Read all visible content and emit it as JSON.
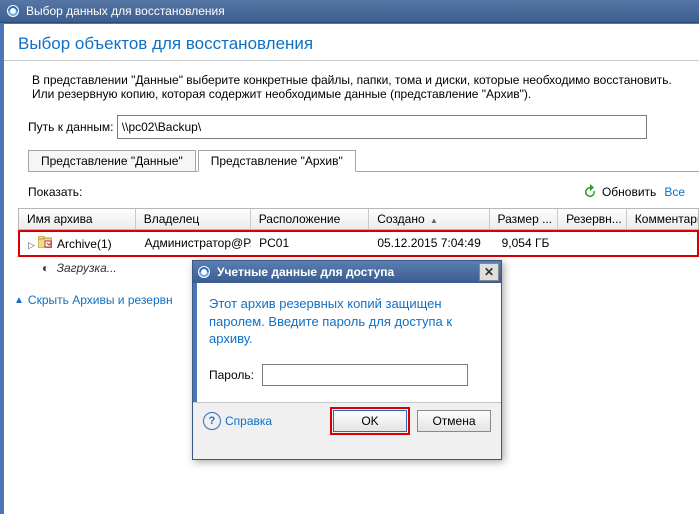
{
  "window": {
    "title": "Выбор данных для восстановления"
  },
  "heading": "Выбор объектов для восстановления",
  "description": "В представлении \"Данные\" выберите конкретные файлы, папки, тома и диски, которые необходимо восстановить. Или резервную копию, которая содержит необходимые данные (представление \"Архив\").",
  "path": {
    "label": "Путь к данным:",
    "value": "\\\\pc02\\Backup\\"
  },
  "tabs": {
    "data": "Представление \"Данные\"",
    "archive": "Представление \"Архив\""
  },
  "filter_label": "Показать:",
  "refresh_label": "Обновить",
  "all_label": "Все",
  "columns": {
    "archive_name": "Имя архива",
    "owner": "Владелец",
    "location": "Расположение",
    "created": "Создано",
    "size": "Размер ...",
    "backup": "Резервн...",
    "comments": "Комментари"
  },
  "rows": [
    {
      "name": "Archive(1)",
      "owner": "Администратор@P...",
      "location": "PC01",
      "created": "05.12.2015 7:04:49",
      "size": "9,054 ГБ"
    }
  ],
  "loading_text": "Загрузка...",
  "hide_link": "Скрыть Архивы и резервн",
  "modal": {
    "title": "Учетные данные для доступа",
    "message": "Этот архив резервных копий защищен паролем. Введите пароль для доступа к архиву.",
    "password_label": "Пароль:",
    "help": "Справка",
    "ok": "OK",
    "cancel": "Отмена"
  }
}
